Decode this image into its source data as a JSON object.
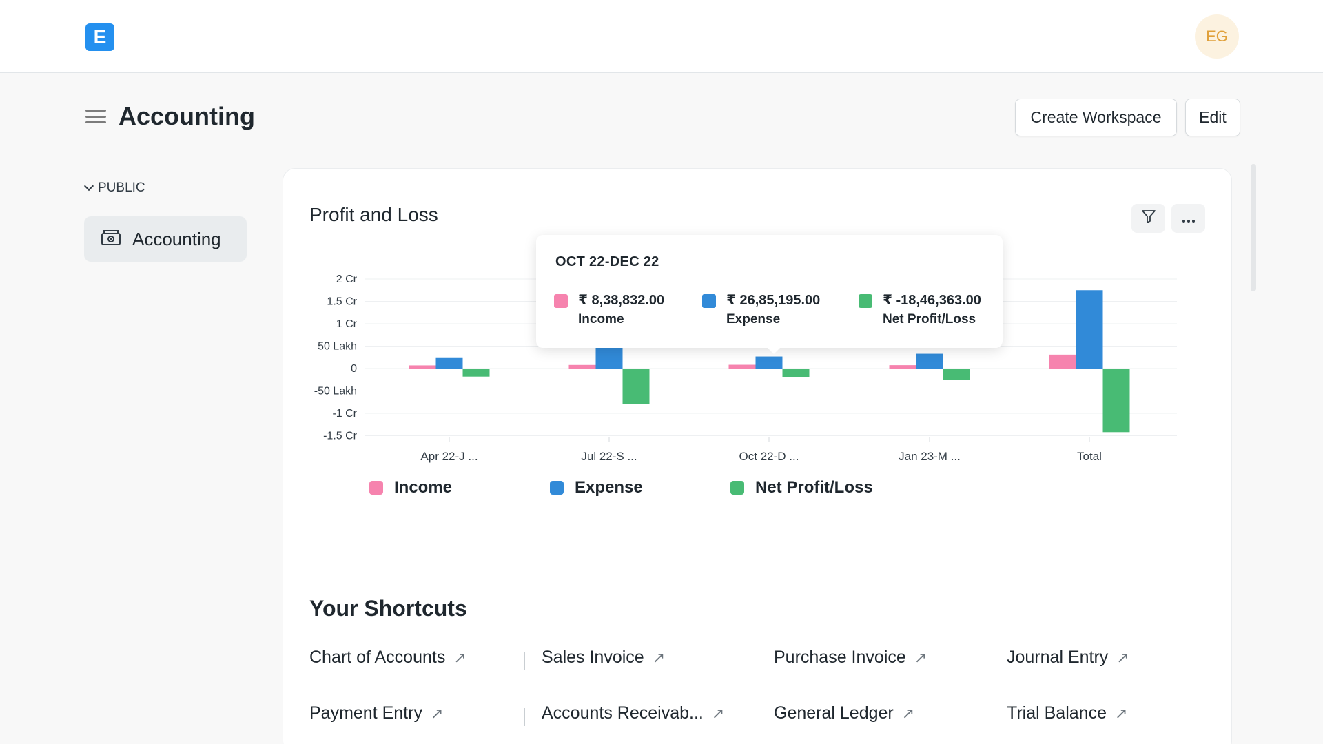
{
  "header": {
    "logo_letter": "E",
    "avatar_initials": "EG"
  },
  "page": {
    "title": "Accounting",
    "create_workspace_label": "Create Workspace",
    "edit_label": "Edit"
  },
  "sidebar": {
    "section_label": "PUBLIC",
    "items": [
      {
        "label": "Accounting",
        "icon": "money-icon"
      }
    ]
  },
  "chart_card": {
    "title": "Profit and Loss",
    "filter_icon": "filter-icon",
    "more_icon": "more-icon"
  },
  "tooltip": {
    "title": "OCT 22-DEC 22",
    "items": [
      {
        "value": "₹ 8,38,832.00",
        "label": "Income",
        "color": "#f683ae"
      },
      {
        "value": "₹ 26,85,195.00",
        "label": "Expense",
        "color": "#318ad8"
      },
      {
        "value": "₹ -18,46,363.00",
        "label": "Net Profit/Loss",
        "color": "#48bb74"
      }
    ]
  },
  "chart_data": {
    "type": "bar",
    "categories": [
      "Apr 22-J ...",
      "Jul 22-S ...",
      "Oct 22-D ...",
      "Jan 23-M ...",
      "Total"
    ],
    "y_tick_labels": [
      "2 Cr",
      "1.5 Cr",
      "1 Cr",
      "50 Lakh",
      "0",
      "-50 Lakh",
      "-1 Cr",
      "-1.5 Cr"
    ],
    "y_tick_values": [
      20000000,
      15000000,
      10000000,
      5000000,
      0,
      -5000000,
      -10000000,
      -15000000
    ],
    "ylim": [
      -15000000,
      20000000
    ],
    "grid": true,
    "legend_position": "bottom",
    "series": [
      {
        "name": "Income",
        "color": "#f683ae",
        "values": [
          700000,
          800000,
          838832,
          750000,
          3100000
        ]
      },
      {
        "name": "Expense",
        "color": "#318ad8",
        "values": [
          2500000,
          6000000,
          2685195,
          3300000,
          17500000
        ]
      },
      {
        "name": "Net Profit/Loss",
        "color": "#48bb74",
        "values": [
          -1800000,
          -8000000,
          -1846363,
          -2500000,
          -14200000
        ]
      }
    ]
  },
  "shortcuts": {
    "title": "Your Shortcuts",
    "items": [
      {
        "label": "Chart of Accounts"
      },
      {
        "label": "Sales Invoice"
      },
      {
        "label": "Purchase Invoice"
      },
      {
        "label": "Journal Entry"
      },
      {
        "label": "Payment Entry"
      },
      {
        "label": "Accounts Receivab..."
      },
      {
        "label": "General Ledger"
      },
      {
        "label": "Trial Balance"
      }
    ]
  }
}
